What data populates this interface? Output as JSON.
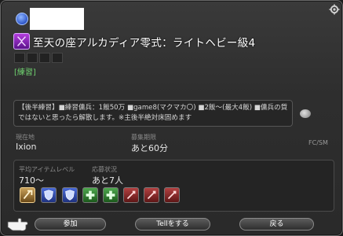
{
  "duty": {
    "title": "至天の座アルカディア零式：ライトヘビー級4",
    "category": "[練習]"
  },
  "comment": {
    "line1": "【後半練習】■練習傭兵：1飯50万 ■game8(マクマカ〇) ■2飯～(最大4飯) ■傭兵の質",
    "line2": "ではないと思ったら解散します。※主後半絶対床固めます"
  },
  "info": {
    "location_label": "現在地",
    "location_value": "Ixion",
    "time_label": "募集期限",
    "time_value": "あと60分",
    "fc_label": "FC/SM"
  },
  "party": {
    "ilvl_label": "平均アイテムレベル",
    "ilvl_value": "710～",
    "status_label": "応募状況",
    "status_value": "あと7人",
    "slots": [
      "tank-filled",
      "tank",
      "tank",
      "healer",
      "healer",
      "dps",
      "dps",
      "dps"
    ]
  },
  "buttons": {
    "join": "参加",
    "tell": "Tellをする",
    "back": "戻る"
  },
  "colors": {
    "category_green": "#6fd16f",
    "duty_icon_purple": "#9a2fd0"
  }
}
